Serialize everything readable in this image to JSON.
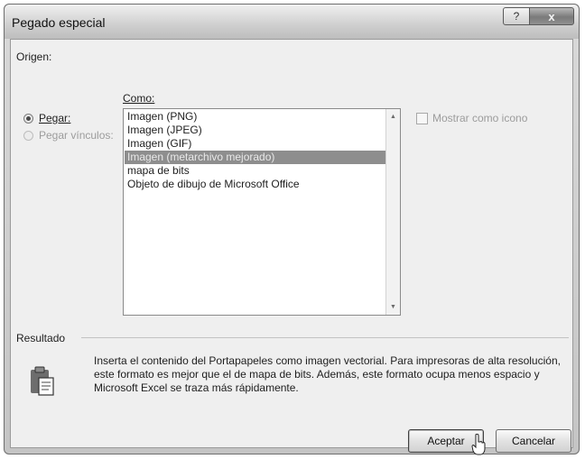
{
  "window": {
    "title": "Pegado especial",
    "help_label": "?",
    "close_label": "x"
  },
  "source": {
    "label": "Origen:"
  },
  "paste_options": {
    "paste": {
      "label": "Pegar:",
      "selected": true
    },
    "paste_link": {
      "label": "Pegar vínculos:",
      "selected": false,
      "enabled": false
    }
  },
  "format_list": {
    "label": "Como:",
    "items": [
      "Imagen (PNG)",
      "Imagen (JPEG)",
      "Imagen (GIF)",
      "Imagen (metarchivo mejorado)",
      "mapa de bits",
      "Objeto de dibujo de Microsoft Office"
    ],
    "selected_index": 3
  },
  "display_as_icon": {
    "label": "Mostrar como icono",
    "checked": false
  },
  "result": {
    "label": "Resultado",
    "icon": "clipboard-icon",
    "text": "Inserta el contenido del Portapapeles como imagen vectorial. Para impresoras de alta resolución, este formato es mejor que el de mapa de bits. Además, este formato ocupa menos espacio y  Microsoft Excel se traza más rápidamente."
  },
  "buttons": {
    "ok": "Aceptar",
    "cancel": "Cancelar"
  },
  "colors": {
    "selection": "#8e8e8e",
    "chrome": "#c4c4c4",
    "client": "#efefef"
  }
}
